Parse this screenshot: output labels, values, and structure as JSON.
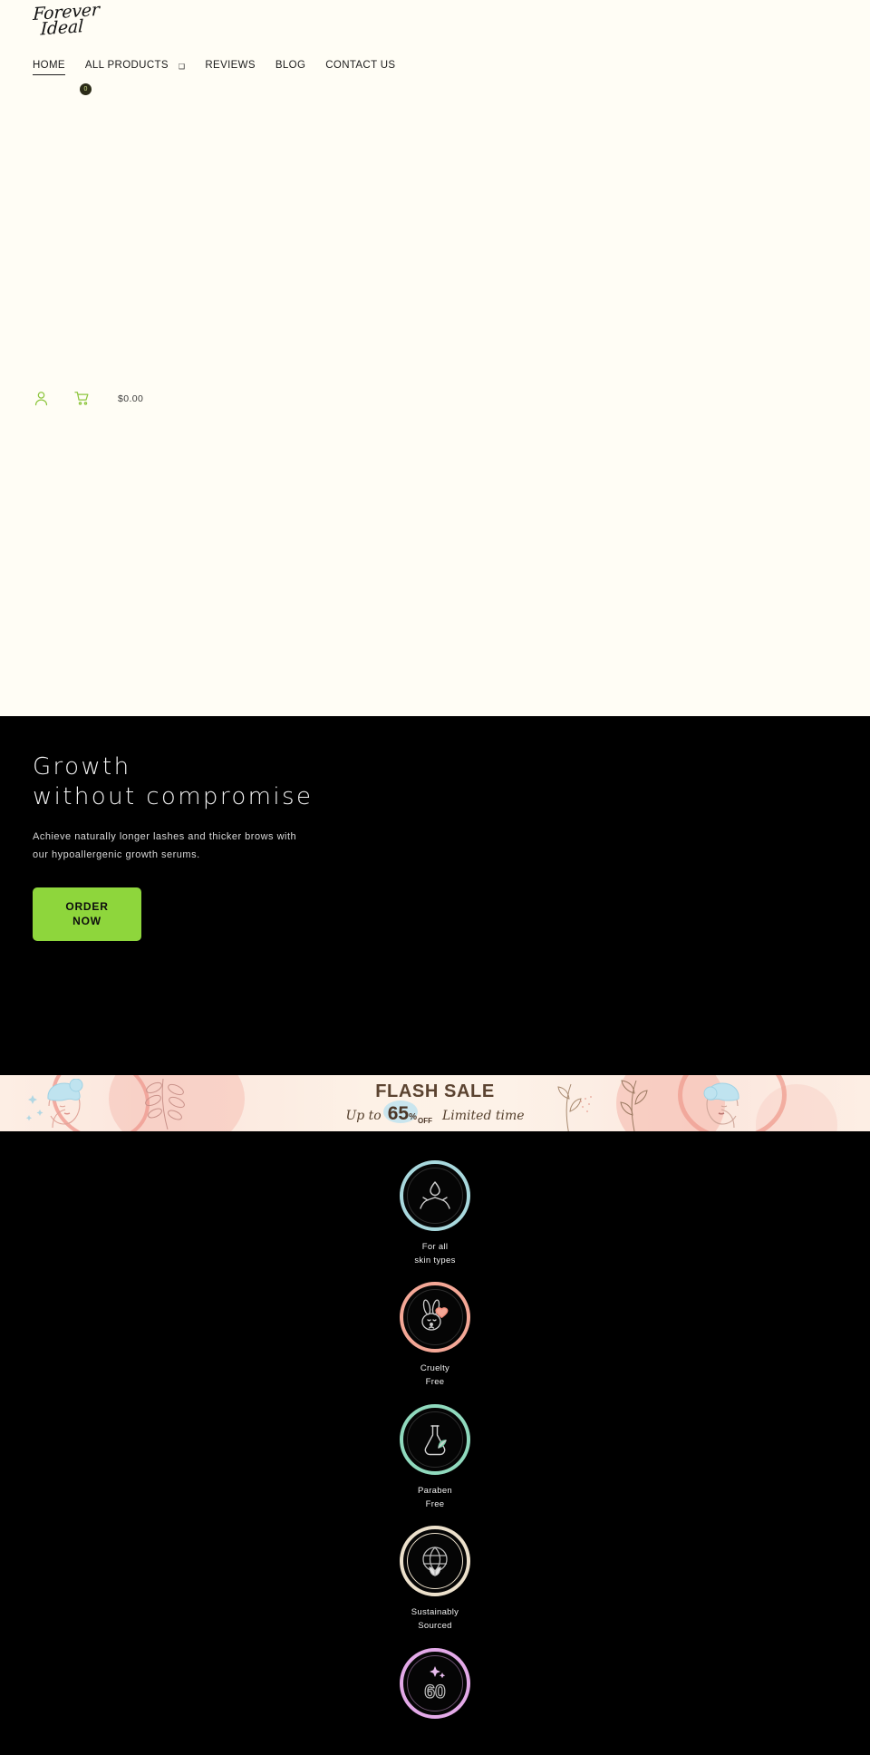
{
  "brand": {
    "name_line1": "Forever",
    "name_line2": "Ideal"
  },
  "nav": {
    "items": [
      {
        "label": "HOME",
        "active": true,
        "has_caret": false
      },
      {
        "label": "ALL PRODUCTS",
        "active": false,
        "has_caret": true,
        "caret": "❑"
      },
      {
        "label": "REVIEWS",
        "active": false,
        "has_caret": false
      },
      {
        "label": "BLOG",
        "active": false,
        "has_caret": false
      },
      {
        "label": "CONTACT US",
        "active": false,
        "has_caret": false
      }
    ],
    "badge_count": "0"
  },
  "utility": {
    "account_icon": "user-icon",
    "cart_icon": "shopping-cart-icon",
    "cart_total": "$0.00",
    "icon_color": "#8ec63f"
  },
  "hero": {
    "title_line1": "Growth",
    "title_line2": "without compromise",
    "subtitle": "Achieve naturally longer lashes and thicker brows with our hypoallergenic growth serums.",
    "cta_line1": "ORDER",
    "cta_line2": "NOW",
    "cta_color": "#8ed63c",
    "background": "#000000"
  },
  "flash_banner": {
    "title": "FLASH SALE",
    "up_to": "Up to",
    "number": "65",
    "percent": "%",
    "off": "OFF",
    "limited": "Limited time",
    "background": "#fdf1e6",
    "text_color": "#5b4330"
  },
  "badges": [
    {
      "icon": "hands-with-droplet-icon",
      "ring_color": "#a8d8dd",
      "label_line1": "For all",
      "label_line2": "skin types"
    },
    {
      "icon": "bunny-with-heart-icon",
      "ring_color": "#f4a796",
      "label_line1": "Cruelty",
      "label_line2": "Free"
    },
    {
      "icon": "flask-with-leaf-icon",
      "ring_color": "#8fd9bd",
      "label_line1": "Paraben",
      "label_line2": "Free"
    },
    {
      "icon": "globe-with-leaf-icon",
      "ring_color": "#ece0cb",
      "label_line1": "Sustainably",
      "label_line2": "Sourced",
      "double_ring": true
    },
    {
      "icon": "sixty-days-sparkle-icon",
      "ring_color": "#e3a9e8",
      "label_line1": "",
      "label_line2": ""
    }
  ]
}
